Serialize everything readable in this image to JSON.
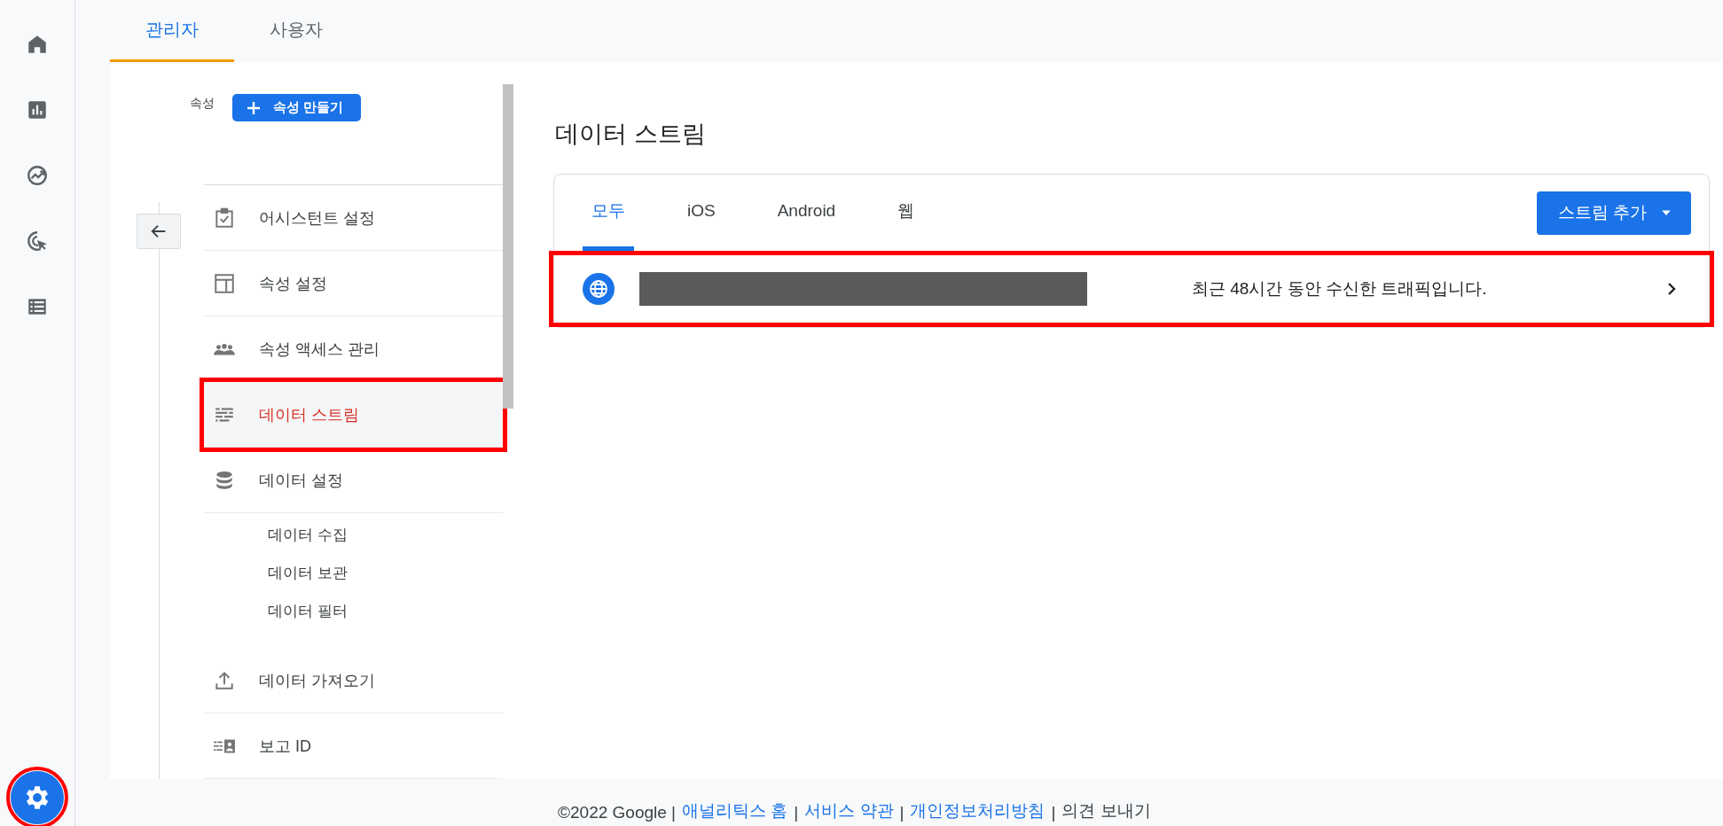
{
  "rail": {
    "items": [
      {
        "selected": false
      },
      {
        "selected": false
      },
      {
        "selected": false
      },
      {
        "selected": false
      },
      {
        "selected": false
      }
    ],
    "settings": {
      "selected": true,
      "highlight": true
    }
  },
  "top_tabs": [
    {
      "label": "관리자",
      "selected": true
    },
    {
      "label": "사용자",
      "selected": false
    }
  ],
  "property": {
    "label": "속성",
    "create_button": "속성 만들기"
  },
  "sidebar": {
    "items": [
      {
        "kind": "item",
        "label": "어시스턴트 설정",
        "selected": false,
        "highlight": false
      },
      {
        "kind": "item",
        "label": "속성 설정",
        "selected": false,
        "highlight": false
      },
      {
        "kind": "item",
        "label": "속성 액세스 관리",
        "selected": false,
        "highlight": false
      },
      {
        "kind": "item",
        "label": "데이터 스트림",
        "selected": true,
        "highlight": true
      },
      {
        "kind": "item",
        "label": "데이터 설정",
        "selected": false,
        "highlight": false
      },
      {
        "kind": "subitem",
        "label": "데이터 수집",
        "selected": false,
        "highlight": false
      },
      {
        "kind": "subitem",
        "label": "데이터 보관",
        "selected": false,
        "highlight": false
      },
      {
        "kind": "subitem",
        "label": "데이터 필터",
        "selected": false,
        "highlight": false
      },
      {
        "kind": "item",
        "label": "데이터 가져오기",
        "selected": false,
        "highlight": false
      },
      {
        "kind": "item",
        "label": "보고 ID",
        "selected": false,
        "highlight": false
      }
    ]
  },
  "page_title": "데이터 스트림",
  "stream_tabs": [
    {
      "label": "모두",
      "selected": true
    },
    {
      "label": "iOS",
      "selected": false
    },
    {
      "label": "Android",
      "selected": false
    },
    {
      "label": "웹",
      "selected": false
    }
  ],
  "add_stream_button": "스트림 추가",
  "streams": [
    {
      "kind": "web",
      "redacted": true,
      "status": "최근 48시간 동안 수신한 트래픽입니다.",
      "highlight": true
    }
  ],
  "footer": [
    {
      "kind": "text",
      "text": "©2022 Google |"
    },
    {
      "kind": "link",
      "text": "애널리틱스 홈"
    },
    {
      "kind": "text",
      "text": "|"
    },
    {
      "kind": "link",
      "text": "서비스 약관"
    },
    {
      "kind": "text",
      "text": "|"
    },
    {
      "kind": "link",
      "text": "개인정보처리방침"
    },
    {
      "kind": "text",
      "text": "|"
    },
    {
      "kind": "text",
      "text": "의견 보내기"
    }
  ]
}
